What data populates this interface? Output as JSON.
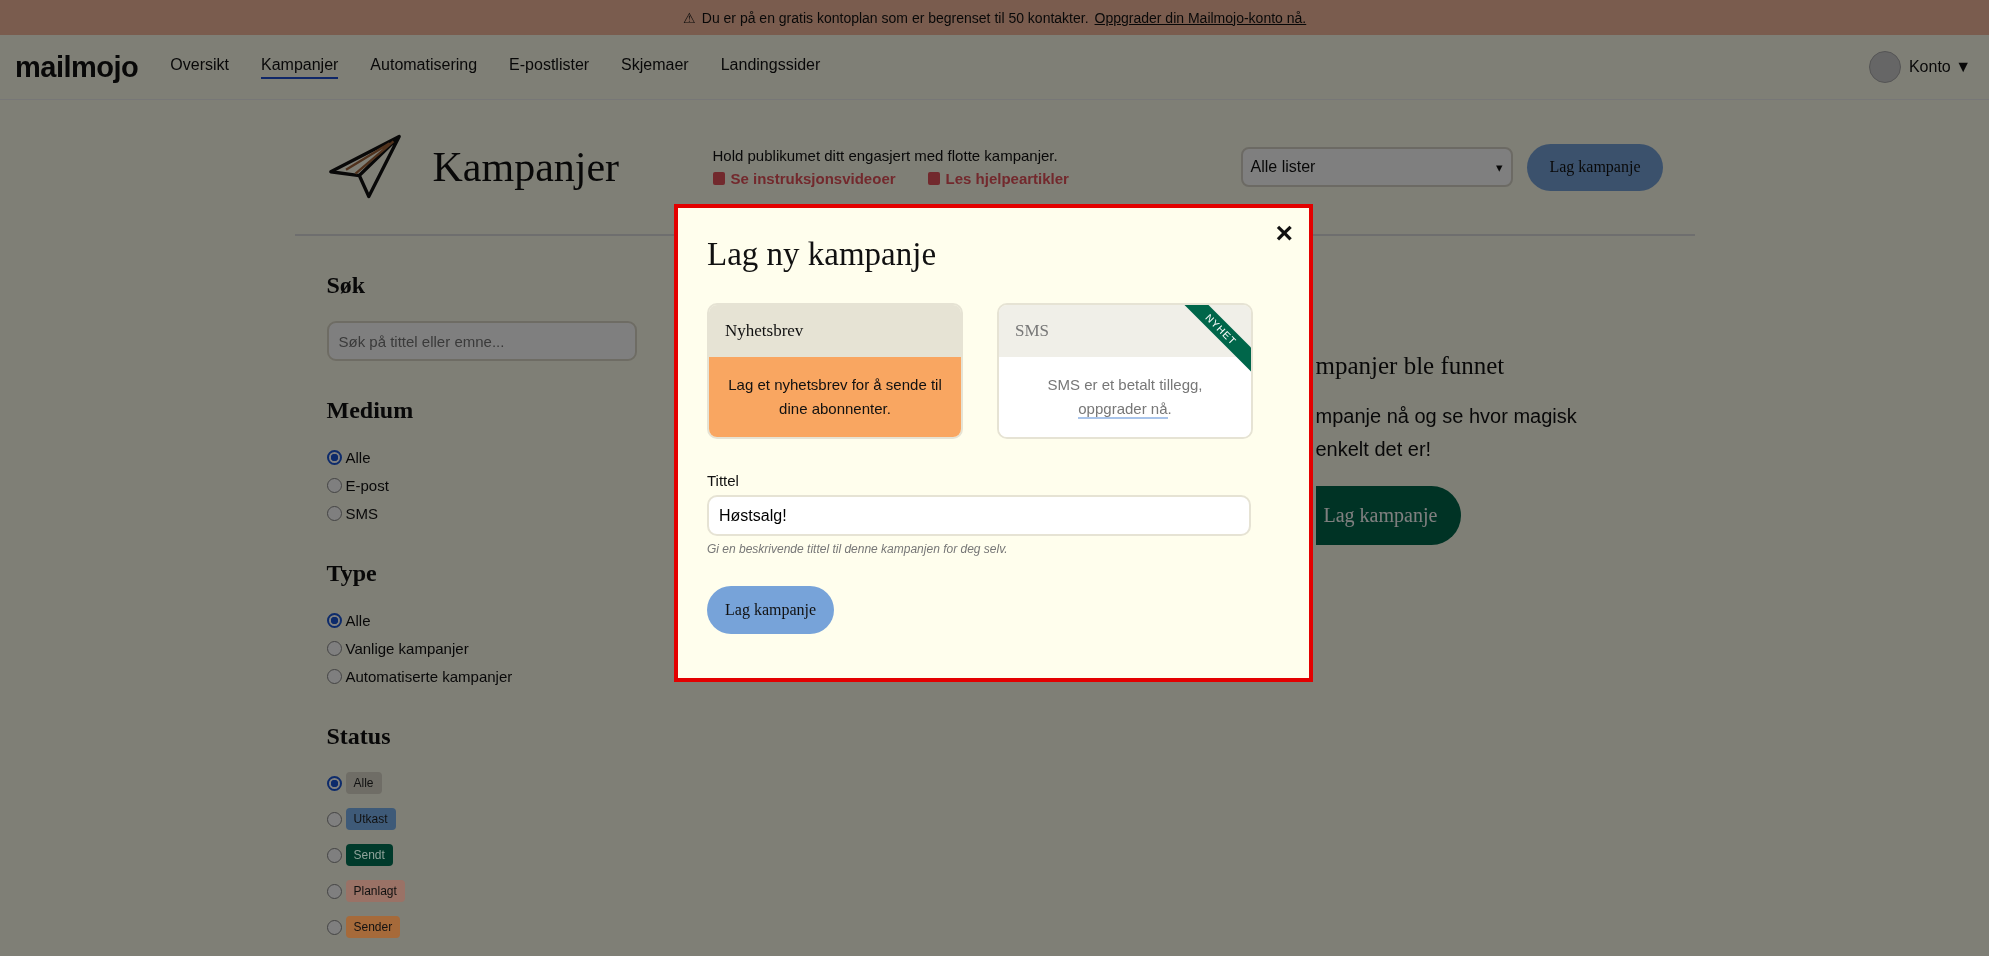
{
  "banner": {
    "icon": "⚠",
    "text": "Du er på en gratis kontoplan som er begrenset til 50 kontakter.",
    "link": "Oppgrader din Mailmojo-konto nå."
  },
  "nav": {
    "logo": "mailmojo",
    "items": [
      {
        "label": "Oversikt",
        "selected": false
      },
      {
        "label": "Kampanjer",
        "selected": true
      },
      {
        "label": "Automatisering",
        "selected": false
      },
      {
        "label": "E-postlister",
        "selected": false
      },
      {
        "label": "Skjemaer",
        "selected": false
      },
      {
        "label": "Landingssider",
        "selected": false
      }
    ],
    "account": "Konto ▼"
  },
  "header": {
    "title": "Kampanjer",
    "description": "Hold publikumet ditt engasjert med flotte kampanjer.",
    "links": [
      "Se instruksjonsvideoer",
      "Les hjelpeartikler"
    ],
    "list_select": "Alle lister",
    "list_select_caret": "▾",
    "button": "Lag kampanje"
  },
  "sidebar": {
    "search": {
      "heading": "Søk",
      "placeholder": "Søk på tittel eller emne..."
    },
    "medium": {
      "heading": "Medium",
      "options": [
        {
          "label": "Alle",
          "selected": true
        },
        {
          "label": "E-post",
          "selected": false
        },
        {
          "label": "SMS",
          "selected": false
        }
      ]
    },
    "type": {
      "heading": "Type",
      "options": [
        {
          "label": "Alle",
          "selected": true
        },
        {
          "label": "Vanlige kampanjer",
          "selected": false
        },
        {
          "label": "Automatiserte kampanjer",
          "selected": false
        }
      ]
    },
    "status": {
      "heading": "Status",
      "options": [
        {
          "label": "Alle",
          "selected": true,
          "color": "#6f6d66"
        },
        {
          "label": "Utkast",
          "selected": false,
          "color": "#3e5a78"
        },
        {
          "label": "Sendt",
          "selected": false,
          "color": "#003a2b"
        },
        {
          "label": "Planlagt",
          "selected": false,
          "color": "#9a7266"
        },
        {
          "label": "Sender",
          "selected": false,
          "color": "#a66a3a"
        }
      ]
    }
  },
  "empty_state": {
    "heading": "mpanjer ble funnet",
    "text_lines": [
      "mpanje nå og se hvor magisk",
      "enkelt det er!"
    ],
    "button": "Lag kampanje"
  },
  "modal": {
    "title": "Lag ny kampanje",
    "close": "×",
    "options": [
      {
        "title": "Nyhetsbrev",
        "description": "Lag et nyhetsbrev for å sende til dine abonnenter.",
        "selected": true
      },
      {
        "title": "SMS",
        "description": "SMS er et betalt tillegg,",
        "link": "oppgrader nå",
        "suffix": ".",
        "selected": false,
        "ribbon": "NYHET"
      }
    ],
    "field": {
      "label": "Tittel",
      "value": "Høstsalg!",
      "help": "Gi en beskrivende tittel til denne kampanjen for deg selv."
    },
    "button": "Lag kampanje"
  }
}
